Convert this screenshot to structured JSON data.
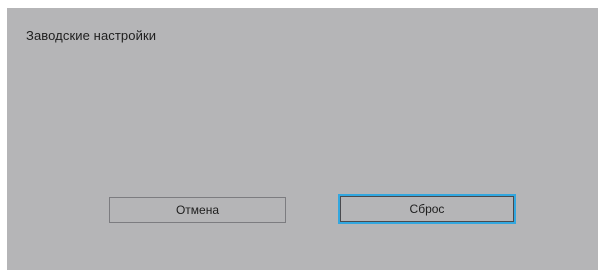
{
  "dialog": {
    "title": "Заводские настройки",
    "cancel_label": "Отмена",
    "reset_label": "Сброс",
    "focused_button": "reset",
    "colors": {
      "background": "#b5b5b7",
      "focus_border": "#33a7df",
      "text": "#1e1e1e"
    }
  }
}
